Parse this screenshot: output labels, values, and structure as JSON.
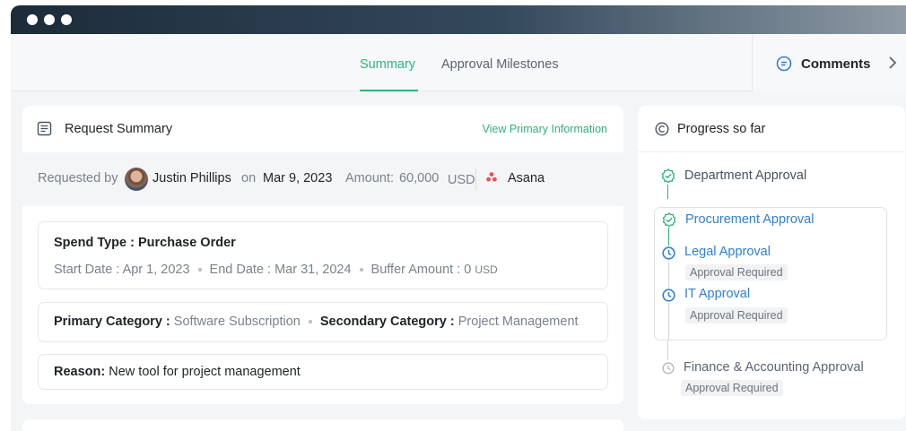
{
  "window": {
    "dots": 3
  },
  "tabs": [
    {
      "label": "Summary",
      "active": true
    },
    {
      "label": "Approval Milestones",
      "active": false
    }
  ],
  "comments": {
    "label": "Comments",
    "icon": "chat-bubble-icon",
    "chevron": "chevron-right-icon"
  },
  "summary": {
    "title": "Request Summary",
    "link": "View Primary Information",
    "requested_by_label": "Requested by",
    "requester": "Justin Phillips",
    "on_label": "on",
    "date": "Mar 9, 2023",
    "amount_label": "Amount:",
    "amount_value": "60,000",
    "amount_currency": "USD",
    "vendor": "Asana",
    "spend_type": "Spend Type : Purchase Order",
    "start_date": "Start Date : Apr 1, 2023",
    "end_date": "End Date : Mar 31, 2024",
    "buffer_label": "Buffer Amount : 0",
    "buffer_currency": "USD",
    "primary_category_label": "Primary Category :",
    "primary_category_value": "Software Subscription",
    "secondary_category_label": "Secondary Category :",
    "secondary_category_value": "Project Management",
    "reason_label": "Reason:",
    "reason_value": "New tool for project management"
  },
  "progress": {
    "title": "Progress so far",
    "steps": [
      {
        "label": "Department Approval",
        "status": "done",
        "note": ""
      },
      {
        "label": "Procurement Approval",
        "status": "done-active",
        "note": ""
      },
      {
        "label": "Legal Approval",
        "status": "in-progress",
        "note": "Approval Required"
      },
      {
        "label": "IT Approval",
        "status": "in-progress",
        "note": "Approval Required"
      },
      {
        "label": "Finance & Accounting Approval",
        "status": "pending",
        "note": "Approval Required"
      }
    ]
  },
  "colors": {
    "accent_green": "#2fb27a",
    "accent_blue": "#2f7ed8",
    "asana": "#e8505b"
  }
}
